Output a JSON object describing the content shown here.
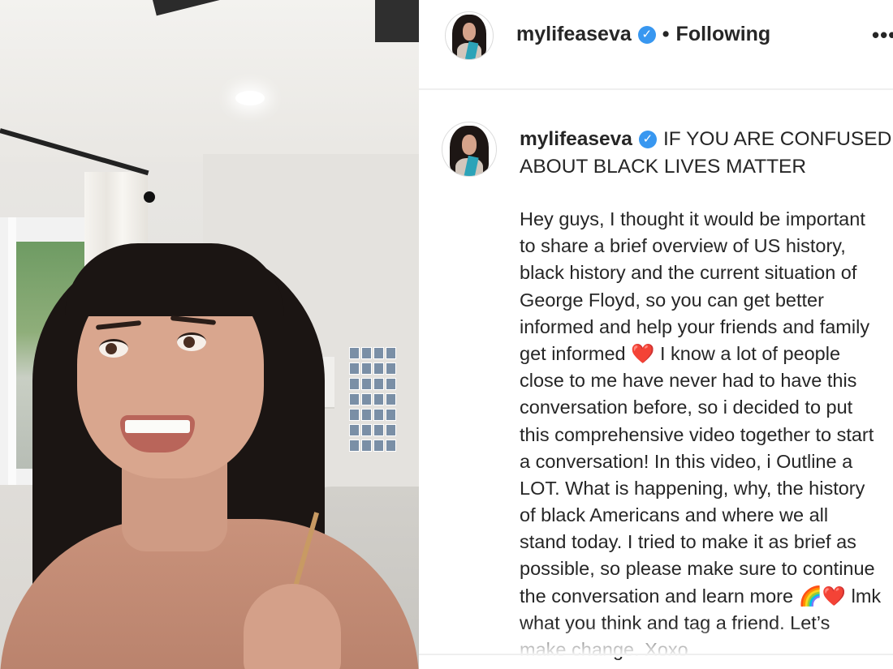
{
  "post": {
    "username": "mylifeaseva",
    "verified_icon": "check-badge-icon",
    "separator": "•",
    "follow_status": "Following",
    "more_label": "•••"
  },
  "caption": {
    "username": "mylifeaseva",
    "title_line_1": "IF YOU ARE CONFUSED",
    "title_line_2": "ABOUT BLACK LIVES MATTER",
    "body_lines": [
      "Hey guys, I thought it would be important",
      "to share a brief overview of US history,",
      "black history and the current situation of",
      "George Floyd, so you can get better",
      "informed and help your friends and family",
      "get informed ❤️ I know a lot of people",
      "close to me have never had to have this",
      "conversation before, so i decided to put",
      "this comprehensive video together to start",
      "a conversation! In this video, i Outline a",
      "LOT. What is happening, why, the history",
      "of black Americans and where we all",
      "stand today. I tried to make it as brief as",
      "possible, so please make sure to continue",
      "the conversation and learn more 🌈❤️ lmk",
      "what you think and tag a friend. Let’s",
      "make change. Xoxo"
    ]
  },
  "colors": {
    "verified_blue": "#3897f0",
    "text": "#262626",
    "divider": "#efefef"
  }
}
